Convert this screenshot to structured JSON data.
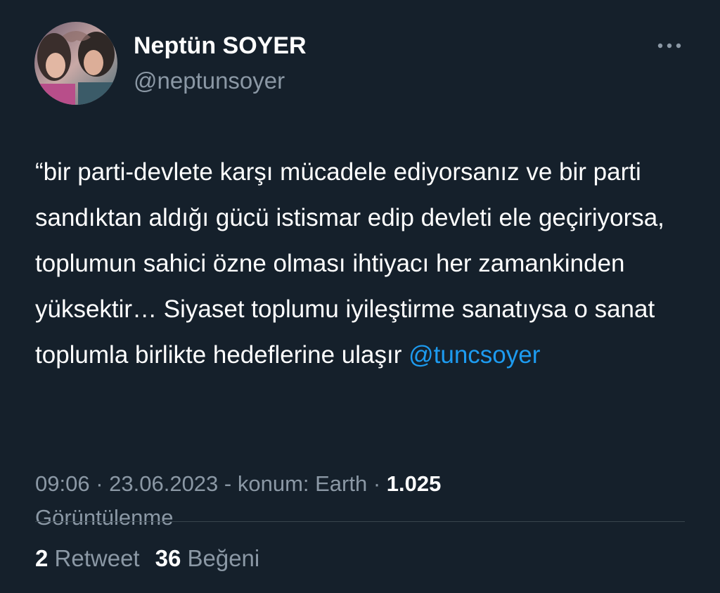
{
  "author": {
    "display_name": "Neptün SOYER",
    "handle": "@neptunsoyer",
    "avatar_icon": "profile-photo"
  },
  "menu": {
    "icon": "more-horizontal-icon"
  },
  "tweet": {
    "text": "“bir parti-devlete karşı mücadele ediyorsanız ve bir parti sandıktan aldığı gücü istismar edip devleti ele geçiriyorsa, toplumun sahici özne olması ihtiyacı her zamankinden yüksektir… Siyaset toplumu iyileştirme sanatıysa o sanat toplumla birlikte hedeflerine ulaşır ",
    "mention": "@tuncsoyer",
    "mention_color": "#1d9bf0"
  },
  "meta": {
    "time": "09:06",
    "sep1": " · ",
    "date": "23.06.2023",
    "sep2": " - ",
    "location": "konum: Earth",
    "sep3": " · ",
    "views_count": "1.025",
    "views_label": "Görüntülenme"
  },
  "stats": {
    "retweets_count": "2",
    "retweets_label": "Retweet",
    "likes_count": "36",
    "likes_label": "Beğeni"
  },
  "colors": {
    "background": "#15202b",
    "text_primary": "#ffffff",
    "text_secondary": "#8b98a5",
    "divider": "#38444d"
  }
}
